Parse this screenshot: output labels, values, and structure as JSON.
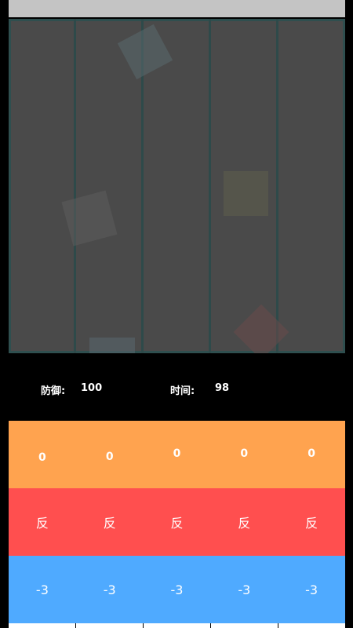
{
  "hud": {
    "defense_label": "防御:",
    "defense_value": "100",
    "time_label": "时间:",
    "time_value": "98"
  },
  "rows": {
    "orange": {
      "color": "#ffa34f",
      "values": [
        "0",
        "0",
        "0",
        "0",
        "0"
      ]
    },
    "red": {
      "color": "#ff4f4f",
      "values": [
        "反",
        "反",
        "反",
        "反",
        "反"
      ]
    },
    "blue": {
      "color": "#4faaff",
      "values": [
        "-3",
        "-3",
        "-3",
        "-3",
        "-3"
      ]
    }
  },
  "colors": {
    "top_bar": "#c4c4c4",
    "arena_background": "#4a4a4a",
    "lane_divider": "#2e4a4a",
    "background": "#000000"
  },
  "blocks": [
    {
      "name": "teal-block",
      "color": "#5a6a6e"
    },
    {
      "name": "gray-block",
      "color": "#5c5c5c"
    },
    {
      "name": "olive-block",
      "color": "#5e5e4c"
    },
    {
      "name": "red-block",
      "color": "#6a4a4a"
    },
    {
      "name": "blue-gray-block",
      "color": "#5a6870"
    }
  ]
}
